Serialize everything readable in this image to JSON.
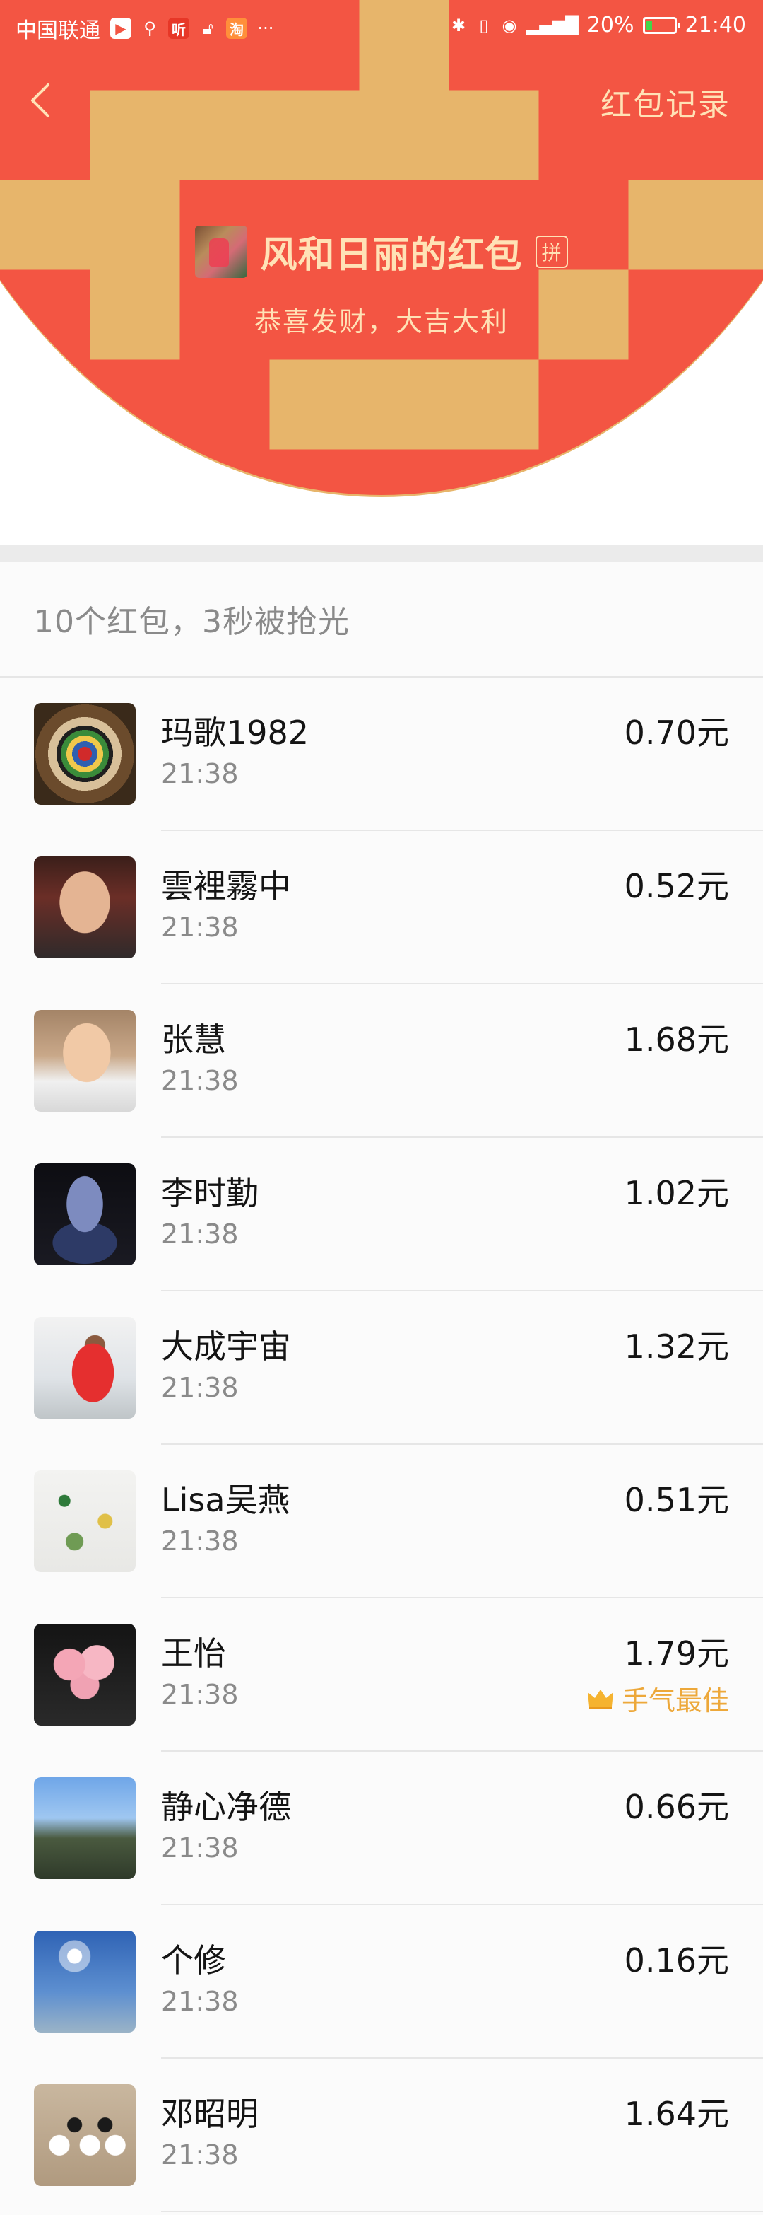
{
  "status_bar": {
    "carrier": "中国联通",
    "battery": "20%",
    "battery_level": 0.2,
    "time": "21:40",
    "left_icons": [
      "app-badge-icon",
      "usb-icon",
      "app-badge-icon",
      "lock-icon",
      "taobao-icon",
      "more-icon"
    ],
    "right_icons": [
      "bluetooth-icon",
      "vibrate-icon",
      "eye-icon",
      "4g-signal-icon",
      "battery-icon"
    ],
    "badge_text": {
      "listen": "听",
      "taobao": "淘"
    }
  },
  "nav": {
    "back_icon": "chevron-left-icon",
    "record_label": "红包记录"
  },
  "sender": {
    "name": "风和日丽的红包",
    "pin_label": "拼",
    "greeting": "恭喜发财，大吉大利"
  },
  "summary": "10个红包，3秒被抢光",
  "colors": {
    "header_red": "#f35543",
    "gold_text": "#ffe2b6",
    "best_luck": "#eda83a"
  },
  "records": [
    {
      "name": "玛歌1982",
      "time": "21:38",
      "amount": "0.70元"
    },
    {
      "name": "雲裡霧中",
      "time": "21:38",
      "amount": "0.52元"
    },
    {
      "name": "张慧",
      "time": "21:38",
      "amount": "1.68元"
    },
    {
      "name": "李时勤",
      "time": "21:38",
      "amount": "1.02元"
    },
    {
      "name": "大成宇宙",
      "time": "21:38",
      "amount": "1.32元"
    },
    {
      "name": "Lisa吴燕",
      "time": "21:38",
      "amount": "0.51元"
    },
    {
      "name": "王怡",
      "time": "21:38",
      "amount": "1.79元",
      "best": "手气最佳"
    },
    {
      "name": "静心净德",
      "time": "21:38",
      "amount": "0.66元"
    },
    {
      "name": "个修",
      "time": "21:38",
      "amount": "0.16元"
    },
    {
      "name": "邓昭明",
      "time": "21:38",
      "amount": "1.64元"
    }
  ]
}
